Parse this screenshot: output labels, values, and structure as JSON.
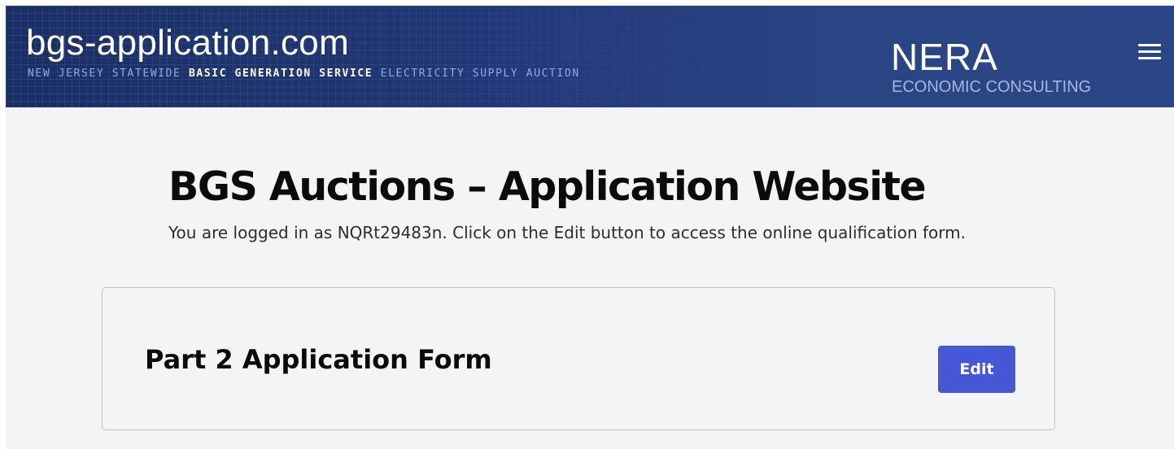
{
  "header": {
    "site_title": "bgs-application.com",
    "tagline_pre": "NEW JERSEY STATEWIDE",
    "tagline_bold": "BASIC GENERATION SERVICE",
    "tagline_post": "ELECTRICITY SUPPLY AUCTION",
    "logo_title": "NERA",
    "logo_subtitle": "ECONOMIC CONSULTING",
    "menu_icon": "hamburger-menu-icon"
  },
  "main": {
    "title": "BGS Auctions – Application Website",
    "intro": "You are logged in as NQRt29483n. Click on the Edit button to access the online qualification form."
  },
  "card": {
    "title": "Part 2 Application Form",
    "edit_label": "Edit"
  },
  "colors": {
    "header_bg": "#22397a",
    "page_bg": "#f3f4f6",
    "button_bg": "#4557d4"
  }
}
